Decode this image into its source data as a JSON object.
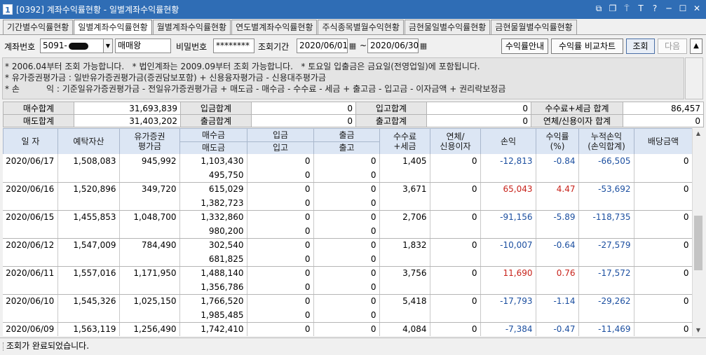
{
  "window": {
    "icon_text": "1",
    "title": "[0392] 계좌수익률현황 - 일별계좌수익률현황",
    "controls": [
      "⧉",
      "❐",
      "⍑",
      "T",
      "?",
      "─",
      "☐",
      "✕"
    ]
  },
  "tabs": [
    {
      "label": "기간별수익률현황",
      "active": false
    },
    {
      "label": "일별계좌수익률현황",
      "active": true
    },
    {
      "label": "월별계좌수익률현황",
      "active": false
    },
    {
      "label": "연도별계좌수익률현황",
      "active": false
    },
    {
      "label": "주식종목별월수익현황",
      "active": false
    },
    {
      "label": "금현물일별수익률현황",
      "active": false
    },
    {
      "label": "금현물월별수익률현황",
      "active": false
    }
  ],
  "search": {
    "account_label": "계좌번호",
    "account_value": "5091-",
    "account_name": "매매왕",
    "password_label": "비밀번호",
    "password_value": "********",
    "period_label": "조회기간",
    "date_from": "2020/06/01",
    "date_sep": "~",
    "date_to": "2020/06/30",
    "btn_profit_guide": "수익률안내",
    "btn_compare_chart": "수익률 비교차트",
    "btn_query": "조회",
    "btn_next": "다음",
    "btn_collapse": "▲"
  },
  "notes": {
    "line1": "* 2006.04부터 조회 가능합니다.   * 법인계좌는 2009.09부터 조회 가능합니다.   * 토요일 입출금은 금요일(전영업일)에 포함됩니다.",
    "line2": "* 유가증권평가금 : 일반유가증권평가금(증권담보포함) + 신용융자평가금 - 신용대주평가금",
    "line3": "* 손          익 : 기준일유가증권평가금 - 전일유가증권평가금 + 매도금 - 매수금 - 수수료 - 세금 + 출고금 - 입고금 - 이자금액 + 권리락보정금"
  },
  "summary": {
    "buy_total_label": "매수합계",
    "buy_total": "31,693,839",
    "deposit_total_label": "입금합계",
    "deposit_total": "0",
    "stock_in_total_label": "입고합계",
    "stock_in_total": "0",
    "fee_tax_total_label": "수수료+세금 합계",
    "fee_tax_total": "86,457",
    "sell_total_label": "매도합계",
    "sell_total": "31,403,202",
    "withdraw_total_label": "출금합계",
    "withdraw_total": "0",
    "stock_out_total_label": "출고합계",
    "stock_out_total": "0",
    "overdue_interest_total_label": "연체/신용이자 합계",
    "overdue_interest_total": "0"
  },
  "grid": {
    "headers": {
      "date": "일 자",
      "deposit_assets": "예탁자산",
      "securities_eval_1": "유가증권",
      "securities_eval_2": "평가금",
      "buy_amount": "매수금",
      "sell_amount": "매도금",
      "deposit": "입금",
      "stock_in": "입고",
      "withdraw": "출금",
      "stock_out": "출고",
      "fee_tax_1": "수수료",
      "fee_tax_2": "+세금",
      "overdue_interest_1": "연체/",
      "overdue_interest_2": "신용이자",
      "profit_loss": "손익",
      "return_rate_1": "수익률",
      "return_rate_2": "(%)",
      "cum_profit_1": "누적손익",
      "cum_profit_2": "(손익합계)",
      "dividend": "배당금액"
    },
    "rows": [
      {
        "date": "2020/06/17",
        "deposit_assets": "1,508,083",
        "securities_eval": "945,992",
        "buy": "1,103,430",
        "sell": "495,750",
        "deposit": "0",
        "stock_in": "0",
        "withdraw": "0",
        "stock_out": "0",
        "fee_tax": "1,405",
        "interest": "0",
        "pnl": "-12,813",
        "rate": "-0.84",
        "cum_pnl": "-66,505",
        "dividend": "0"
      },
      {
        "date": "2020/06/16",
        "deposit_assets": "1,520,896",
        "securities_eval": "349,720",
        "buy": "615,029",
        "sell": "1,382,723",
        "deposit": "0",
        "stock_in": "0",
        "withdraw": "0",
        "stock_out": "0",
        "fee_tax": "3,671",
        "interest": "0",
        "pnl": "65,043",
        "rate": "4.47",
        "cum_pnl": "-53,692",
        "dividend": "0"
      },
      {
        "date": "2020/06/15",
        "deposit_assets": "1,455,853",
        "securities_eval": "1,048,700",
        "buy": "1,332,860",
        "sell": "980,200",
        "deposit": "0",
        "stock_in": "0",
        "withdraw": "0",
        "stock_out": "0",
        "fee_tax": "2,706",
        "interest": "0",
        "pnl": "-91,156",
        "rate": "-5.89",
        "cum_pnl": "-118,735",
        "dividend": "0"
      },
      {
        "date": "2020/06/12",
        "deposit_assets": "1,547,009",
        "securities_eval": "784,490",
        "buy": "302,540",
        "sell": "681,825",
        "deposit": "0",
        "stock_in": "0",
        "withdraw": "0",
        "stock_out": "0",
        "fee_tax": "1,832",
        "interest": "0",
        "pnl": "-10,007",
        "rate": "-0.64",
        "cum_pnl": "-27,579",
        "dividend": "0"
      },
      {
        "date": "2020/06/11",
        "deposit_assets": "1,557,016",
        "securities_eval": "1,171,950",
        "buy": "1,488,140",
        "sell": "1,356,786",
        "deposit": "0",
        "stock_in": "0",
        "withdraw": "0",
        "stock_out": "0",
        "fee_tax": "3,756",
        "interest": "0",
        "pnl": "11,690",
        "rate": "0.76",
        "cum_pnl": "-17,572",
        "dividend": "0"
      },
      {
        "date": "2020/06/10",
        "deposit_assets": "1,545,326",
        "securities_eval": "1,025,150",
        "buy": "1,766,520",
        "sell": "1,985,485",
        "deposit": "0",
        "stock_in": "0",
        "withdraw": "0",
        "stock_out": "0",
        "fee_tax": "5,418",
        "interest": "0",
        "pnl": "-17,793",
        "rate": "-1.14",
        "cum_pnl": "-29,262",
        "dividend": "0"
      },
      {
        "date": "2020/06/09",
        "deposit_assets": "1,563,119",
        "securities_eval": "1,256,490",
        "buy": "1,742,410",
        "sell": "",
        "deposit": "0",
        "stock_in": "0",
        "withdraw": "0",
        "stock_out": "0",
        "fee_tax": "4,084",
        "interest": "0",
        "pnl": "-7,384",
        "rate": "-0.47",
        "cum_pnl": "-11,469",
        "dividend": "0"
      }
    ],
    "colors": {
      "positive": "#c8231b",
      "negative": "#1c4fa0"
    }
  },
  "status": {
    "message": "조회가 완료되었습니다."
  }
}
